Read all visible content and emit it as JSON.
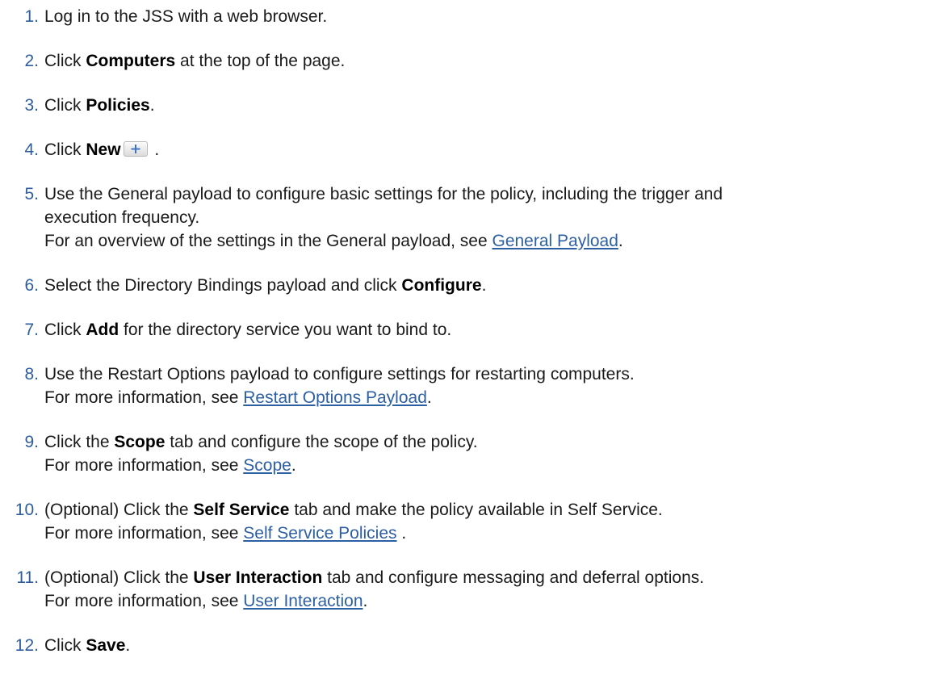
{
  "steps": [
    {
      "num": "1.",
      "t1": "Log in to the JSS with a web browser."
    },
    {
      "num": "2.",
      "pre": "Click ",
      "bold": "Computers",
      "post": " at the top of the page."
    },
    {
      "num": "3.",
      "pre": "Click ",
      "bold": "Policies",
      "post": "."
    },
    {
      "num": "4.",
      "pre": "Click ",
      "bold": "New",
      "post": " .",
      "icon": "plus-icon"
    },
    {
      "num": "5.",
      "l1": "Use the General payload to configure basic settings for the policy, including the trigger and",
      "l2": "execution frequency.",
      "l3pre": "For an overview of the settings in the General payload, see ",
      "link": "General Payload",
      "l3post": "."
    },
    {
      "num": "6.",
      "pre": "Select the Directory Bindings payload and click ",
      "bold": "Configure",
      "post": "."
    },
    {
      "num": "7.",
      "pre": "Click ",
      "bold": "Add",
      "post": " for the directory service you want to bind to."
    },
    {
      "num": "8.",
      "l1": "Use the Restart Options payload to configure settings for restarting computers.",
      "l2pre": "For more information, see ",
      "link": "Restart Options Payload",
      "l2post": "."
    },
    {
      "num": "9.",
      "pre": "Click the ",
      "bold": "Scope",
      "post": " tab and configure the scope of the policy.",
      "l2pre": "For more information, see ",
      "link": "Scope",
      "l2post": "."
    },
    {
      "num": "10.",
      "pre": "(Optional) Click the ",
      "bold": "Self Service",
      "post": " tab and make the policy available in Self Service.",
      "l2pre": "For more information, see ",
      "link": "Self Service Policies",
      "l2post": " ."
    },
    {
      "num": "11.",
      "pre": "(Optional) Click the ",
      "bold": "User Interaction",
      "post": " tab and configure messaging and deferral options.",
      "l2pre": "For more information, see ",
      "link": "User Interaction",
      "l2post": "."
    },
    {
      "num": "12.",
      "pre": "Click ",
      "bold": "Save",
      "post": "."
    }
  ]
}
